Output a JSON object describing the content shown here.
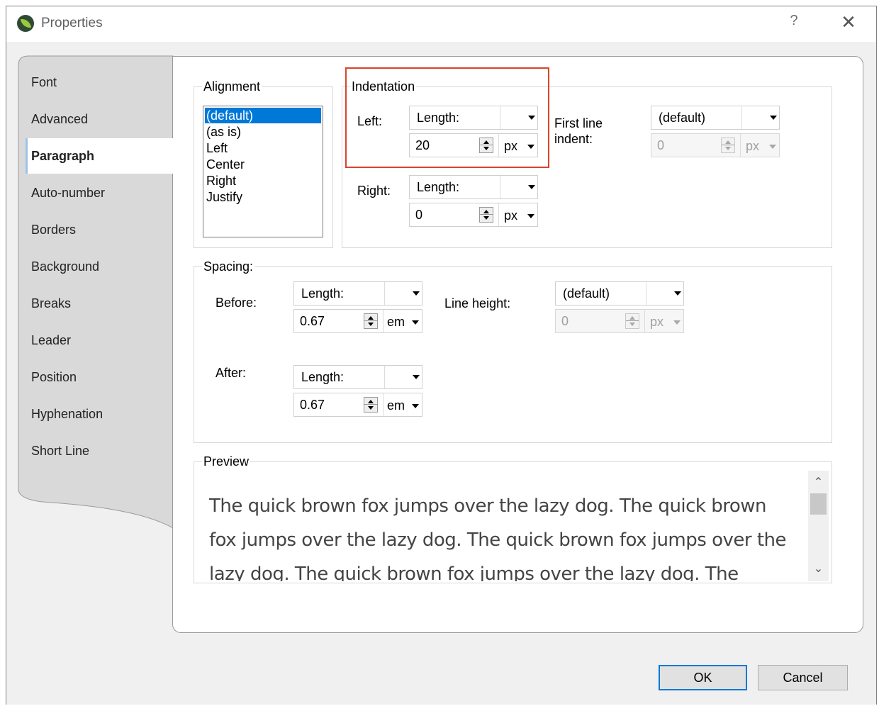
{
  "window": {
    "title": "Properties",
    "help_glyph": "?",
    "close_glyph": "✕"
  },
  "tabs": [
    "Font",
    "Advanced",
    "Paragraph",
    "Auto-number",
    "Borders",
    "Background",
    "Breaks",
    "Leader",
    "Position",
    "Hyphenation",
    "Short Line"
  ],
  "selected_tab": "Paragraph",
  "alignment": {
    "label": "Alignment",
    "options": [
      "(default)",
      "(as is)",
      "Left",
      "Center",
      "Right",
      "Justify"
    ],
    "selected": "(default)"
  },
  "indentation": {
    "label": "Indentation",
    "left": {
      "label": "Left:",
      "type": "Length:",
      "value": "20",
      "unit": "px"
    },
    "right": {
      "label": "Right:",
      "type": "Length:",
      "value": "0",
      "unit": "px"
    },
    "first_line": {
      "label_line1": "First line",
      "label_line2": "indent:",
      "type": "(default)",
      "value": "0",
      "unit": "px"
    }
  },
  "spacing": {
    "label": "Spacing:",
    "before": {
      "label": "Before:",
      "type": "Length:",
      "value": "0.67",
      "unit": "em"
    },
    "after": {
      "label": "After:",
      "type": "Length:",
      "value": "0.67",
      "unit": "em"
    },
    "line_height": {
      "label": "Line height:",
      "type": "(default)",
      "value": "0",
      "unit": "px"
    }
  },
  "preview": {
    "label": "Preview",
    "text": "The quick brown fox jumps over the lazy dog. The quick brown fox jumps over the lazy dog. The quick brown fox jumps over the lazy dog. The quick brown fox jumps over the lazy dog. The"
  },
  "buttons": {
    "ok": "OK",
    "cancel": "Cancel"
  },
  "colors": {
    "accent": "#0078d7",
    "highlight_box": "#d9452b"
  }
}
